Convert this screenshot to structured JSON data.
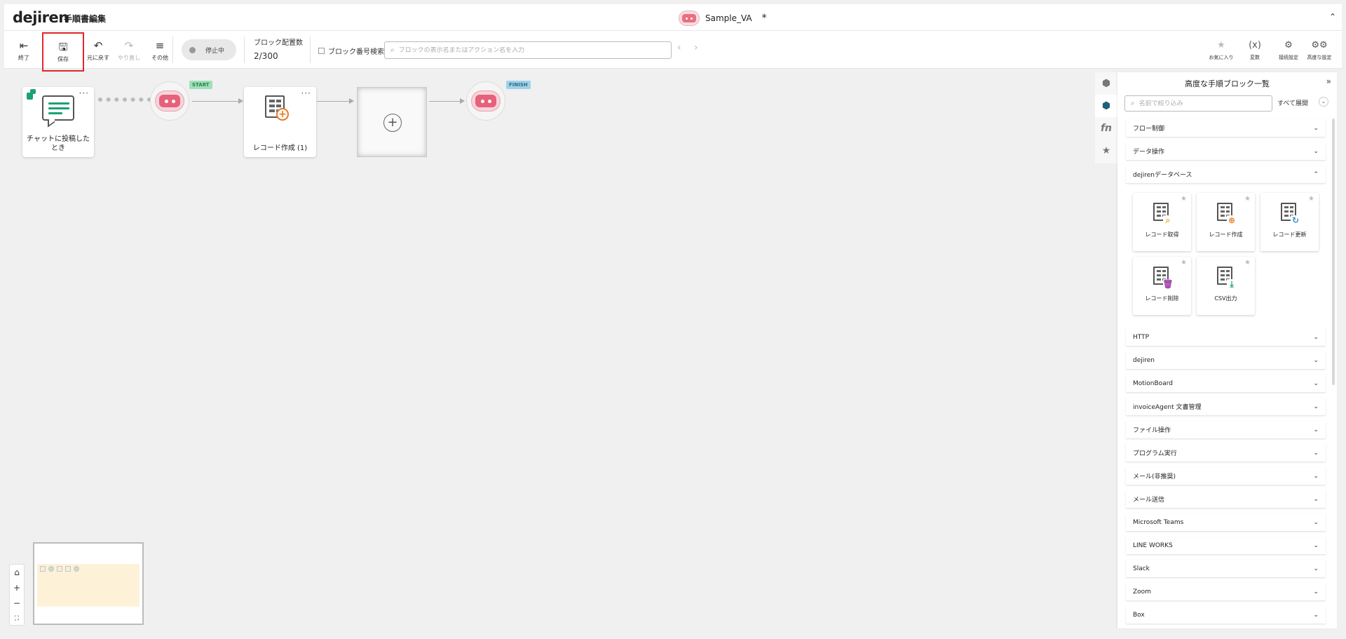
{
  "header": {
    "logo": "dejiren",
    "title": "手順書編集",
    "va_name": "Sample_VA",
    "dirty_mark": "*",
    "collapse_icon": "chevron-double-up-icon"
  },
  "toolbar": {
    "exit_label": "終了",
    "save_label": "保存",
    "undo_label": "元に戻す",
    "redo_label": "やり直し",
    "more_label": "その他",
    "status_label": "停止中",
    "block_count_label": "ブロック配置数",
    "block_count_value": "2/300",
    "block_number_search_label": "ブロック番号検索",
    "search_placeholder": "ブロックの表示名またはアクション名を入力",
    "favorites_label": "お気に入り",
    "variables_label": "変数",
    "connection_label": "接続設定",
    "advanced_label": "高度な設定",
    "save_highlight_color": "#e0262b"
  },
  "canvas": {
    "trigger_block_label": "チャットに投稿したとき",
    "record_create_block_label": "レコード作成 (1)",
    "start_tag": "START",
    "finish_tag": "FINISH",
    "accent_green": "#1ba272",
    "accent_orange": "#e67a22",
    "robot_pink": "#e6617a"
  },
  "panel": {
    "title": "高度な手順ブロック一覧",
    "filter_placeholder": "名前で絞り込み",
    "expand_all_label": "すべて展開",
    "categories_top": [
      {
        "label": "フロー制御",
        "expanded": false
      },
      {
        "label": "データ操作",
        "expanded": false
      },
      {
        "label": "dejirenデータベース",
        "expanded": true
      }
    ],
    "dejiren_db_blocks": [
      {
        "label": "レコード取得",
        "icon": "record-get-icon",
        "badge_color": "#e8b820"
      },
      {
        "label": "レコード作成",
        "icon": "record-create-icon",
        "badge_color": "#e67a22"
      },
      {
        "label": "レコード更新",
        "icon": "record-update-icon",
        "badge_color": "#2f8fcf"
      },
      {
        "label": "レコード削除",
        "icon": "record-delete-icon",
        "badge_color": "#9c3fa8"
      },
      {
        "label": "CSV出力",
        "icon": "csv-export-icon",
        "badge_color": "#1ba272"
      }
    ],
    "categories_bottom": [
      {
        "label": "HTTP"
      },
      {
        "label": "dejiren"
      },
      {
        "label": "MotionBoard"
      },
      {
        "label": "invoiceAgent 文書管理"
      },
      {
        "label": "ファイル操作"
      },
      {
        "label": "プログラム実行"
      },
      {
        "label": "メール(非推奨)"
      },
      {
        "label": "メール送信"
      },
      {
        "label": "Microsoft Teams"
      },
      {
        "label": "LINE WORKS"
      },
      {
        "label": "Slack"
      },
      {
        "label": "Zoom"
      },
      {
        "label": "Box"
      }
    ]
  }
}
